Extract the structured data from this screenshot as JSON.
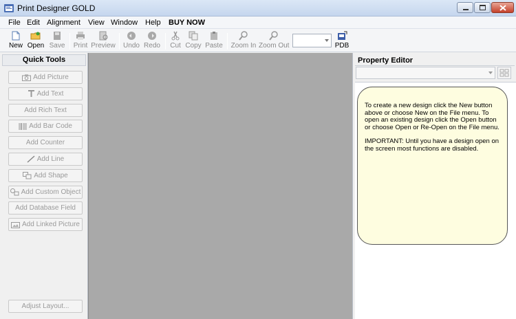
{
  "window": {
    "title": "Print Designer GOLD",
    "controls": {
      "minimize": "minimize",
      "maximize": "maximize",
      "close": "close"
    }
  },
  "menu": {
    "items": [
      "File",
      "Edit",
      "Alignment",
      "View",
      "Window",
      "Help",
      "BUY NOW"
    ]
  },
  "toolbar": {
    "buttons": [
      {
        "label": "New",
        "icon": "new-document-icon",
        "enabled": true
      },
      {
        "label": "Open",
        "icon": "open-folder-icon",
        "enabled": true
      },
      {
        "label": "Save",
        "icon": "save-disk-icon",
        "enabled": false
      },
      {
        "label": "Print",
        "icon": "printer-icon",
        "enabled": false
      },
      {
        "label": "Preview",
        "icon": "preview-icon",
        "enabled": false
      },
      {
        "label": "Undo",
        "icon": "undo-icon",
        "enabled": false
      },
      {
        "label": "Redo",
        "icon": "redo-icon",
        "enabled": false
      },
      {
        "label": "Cut",
        "icon": "scissors-icon",
        "enabled": false
      },
      {
        "label": "Copy",
        "icon": "copy-icon",
        "enabled": false
      },
      {
        "label": "Paste",
        "icon": "paste-icon",
        "enabled": false
      },
      {
        "label": "Zoom In",
        "icon": "zoom-in-icon",
        "enabled": false
      },
      {
        "label": "Zoom Out",
        "icon": "zoom-out-icon",
        "enabled": false
      },
      {
        "label": "PDB",
        "icon": "pdb-icon",
        "enabled": true
      }
    ],
    "zoom_value": ""
  },
  "quick_tools": {
    "header": "Quick Tools",
    "buttons": [
      {
        "label": "Add Picture",
        "icon": "camera-icon"
      },
      {
        "label": "Add Text",
        "icon": "text-t-icon"
      },
      {
        "label": "Add Rich Text",
        "icon": ""
      },
      {
        "label": "Add Bar Code",
        "icon": "barcode-icon"
      },
      {
        "label": "Add Counter",
        "icon": ""
      },
      {
        "label": "Add Line",
        "icon": "line-icon"
      },
      {
        "label": "Add Shape",
        "icon": "shape-icon"
      },
      {
        "label": "Add Custom Object",
        "icon": "custom-object-icon"
      },
      {
        "label": "Add Database Field",
        "icon": ""
      },
      {
        "label": "Add Linked Picture",
        "icon": "linked-picture-icon"
      }
    ],
    "adjust_layout": "Adjust Layout..."
  },
  "property_editor": {
    "header": "Property Editor",
    "combo_value": "",
    "help_paragraph_1": "To create a new design click the New button above or choose New on the File menu. To open an existing design click the Open button or choose Open or Re-Open on the File menu.",
    "help_paragraph_2": "IMPORTANT: Until you have a design open on the screen most functions are disabled."
  },
  "colors": {
    "canvas": "#a9a9a9",
    "help_bubble": "#fefde0",
    "title_bar": "#c5d6ee",
    "disabled_text": "#9a9a9a"
  }
}
